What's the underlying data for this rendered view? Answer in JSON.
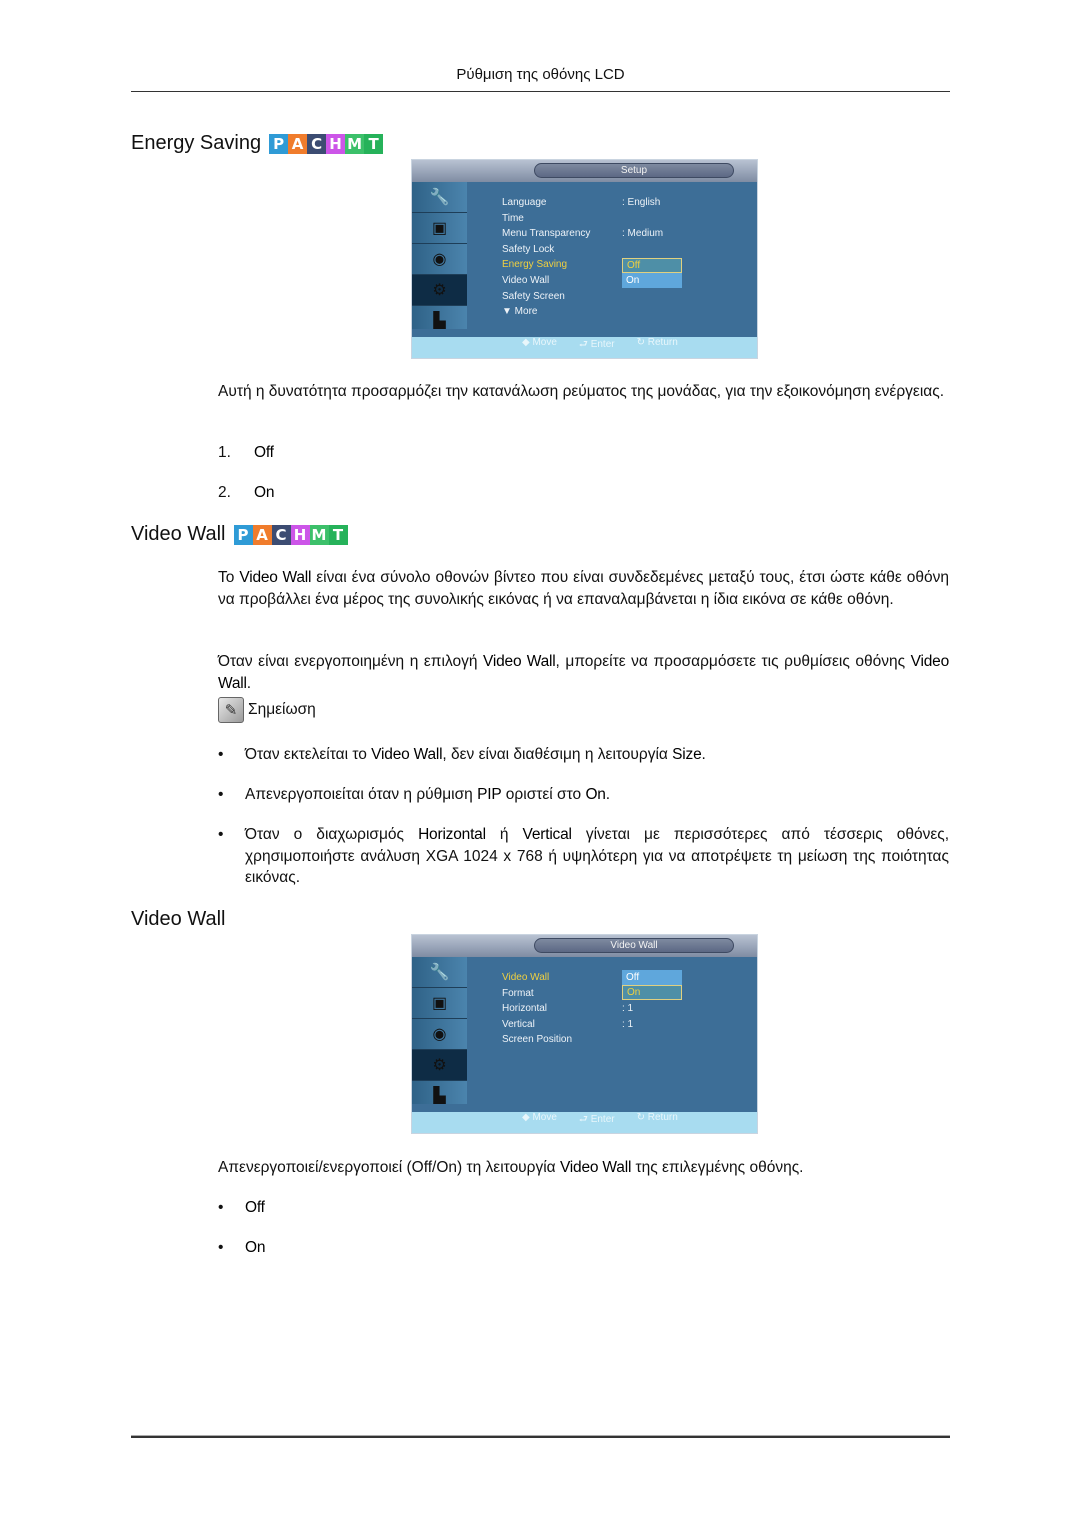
{
  "header": {
    "title": "Ρύθμιση της οθόνης LCD"
  },
  "badges": [
    {
      "letter": "P",
      "color": "#2f9bd6"
    },
    {
      "letter": "A",
      "color": "#f07c2c"
    },
    {
      "letter": "C",
      "color": "#3c4c72"
    },
    {
      "letter": "H",
      "color": "#cc55e8"
    },
    {
      "letter": "M",
      "color": "#3cc06a"
    },
    {
      "letter": "T",
      "color": "#26b25a"
    }
  ],
  "energy_saving": {
    "title": "Energy Saving",
    "osd": {
      "title": "Setup",
      "menu": [
        {
          "label": "Language",
          "value": ": English"
        },
        {
          "label": "Time",
          "value": ""
        },
        {
          "label": "Menu Transparency",
          "value": ": Medium"
        },
        {
          "label": "Safety Lock",
          "value": ""
        },
        {
          "label": "Energy Saving",
          "value": ":",
          "highlighted": true
        },
        {
          "label": "Video Wall",
          "value": ""
        },
        {
          "label": "Safety Screen",
          "value": ""
        },
        {
          "label": "▼ More",
          "value": ""
        }
      ],
      "dropdown": [
        "Off",
        "On"
      ],
      "dropdown_selected": "Off",
      "nav": {
        "move": "◆ Move",
        "enter": "⮐ Enter",
        "return": "↻ Return"
      }
    },
    "description": "Αυτή η δυνατότητα προσαρμόζει την κατανάλωση ρεύματος της μονάδας, για την εξοικονόμηση ενέργειας.",
    "options": [
      {
        "num": "1.",
        "label": "Off"
      },
      {
        "num": "2.",
        "label": "On"
      }
    ]
  },
  "video_wall": {
    "title": "Video Wall",
    "para1": {
      "pre": "Το ",
      "bold": "Video Wall",
      "post": " είναι ένα σύνολο οθονών βίντεο που είναι συνδεδεμένες μεταξύ τους, έτσι ώστε κάθε οθόνη να προβάλλει ένα μέρος της συνολικής εικόνας ή να επαναλαμβάνεται η ίδια εικόνα σε κάθε οθόνη."
    },
    "para2": {
      "pre": "Όταν είναι ενεργοποιημένη η επιλογή ",
      "bold1": "Video Wall",
      "mid": ", μπορείτε να προσαρμόσετε τις ρυθμίσεις οθόνης ",
      "bold2": "Video Wall",
      "post": "."
    },
    "note_label": "Σημείωση",
    "notes": [
      {
        "pre": "Όταν εκτελείται το ",
        "b1": "Video Wall",
        "mid": ", δεν είναι διαθέσιμη η λειτουργία ",
        "b2": "Size",
        "post": "."
      },
      {
        "pre": "Απενεργοποιείται όταν η ρύθμιση ",
        "b1": "PIP",
        "mid": " οριστεί στο ",
        "b2": "On",
        "post": "."
      },
      {
        "pre": "Όταν ο διαχωρισμός ",
        "b1": "Horizontal",
        "mid": " ή ",
        "b2": "Vertical",
        "post": " γίνεται με περισσότερες από τέσσερις οθόνες, χρησιμοποιήστε ανάλυση XGA 1024 x 768 ή υψηλότερη για να αποτρέψετε τη μείωση της ποιότητας εικόνας."
      }
    ]
  },
  "video_wall_sub": {
    "title": "Video Wall",
    "osd": {
      "title": "Video Wall",
      "menu": [
        {
          "label": "Video Wall",
          "value": ":",
          "highlighted": true
        },
        {
          "label": "Format",
          "value": ":"
        },
        {
          "label": "Horizontal",
          "value": ": 1"
        },
        {
          "label": "Vertical",
          "value": ": 1"
        },
        {
          "label": "Screen Position",
          "value": ""
        }
      ],
      "dropdown": [
        "Off",
        "On"
      ],
      "dropdown_selected": "On",
      "nav": {
        "move": "◆ Move",
        "enter": "⮐ Enter",
        "return": "↻ Return"
      }
    },
    "description": {
      "pre": "Απενεργοποιεί/ενεργοποιεί (Off/On) τη λειτουργία ",
      "bold": "Video Wall",
      "post": " της επιλεγμένης οθόνης."
    },
    "options": [
      "Off",
      "On"
    ]
  }
}
